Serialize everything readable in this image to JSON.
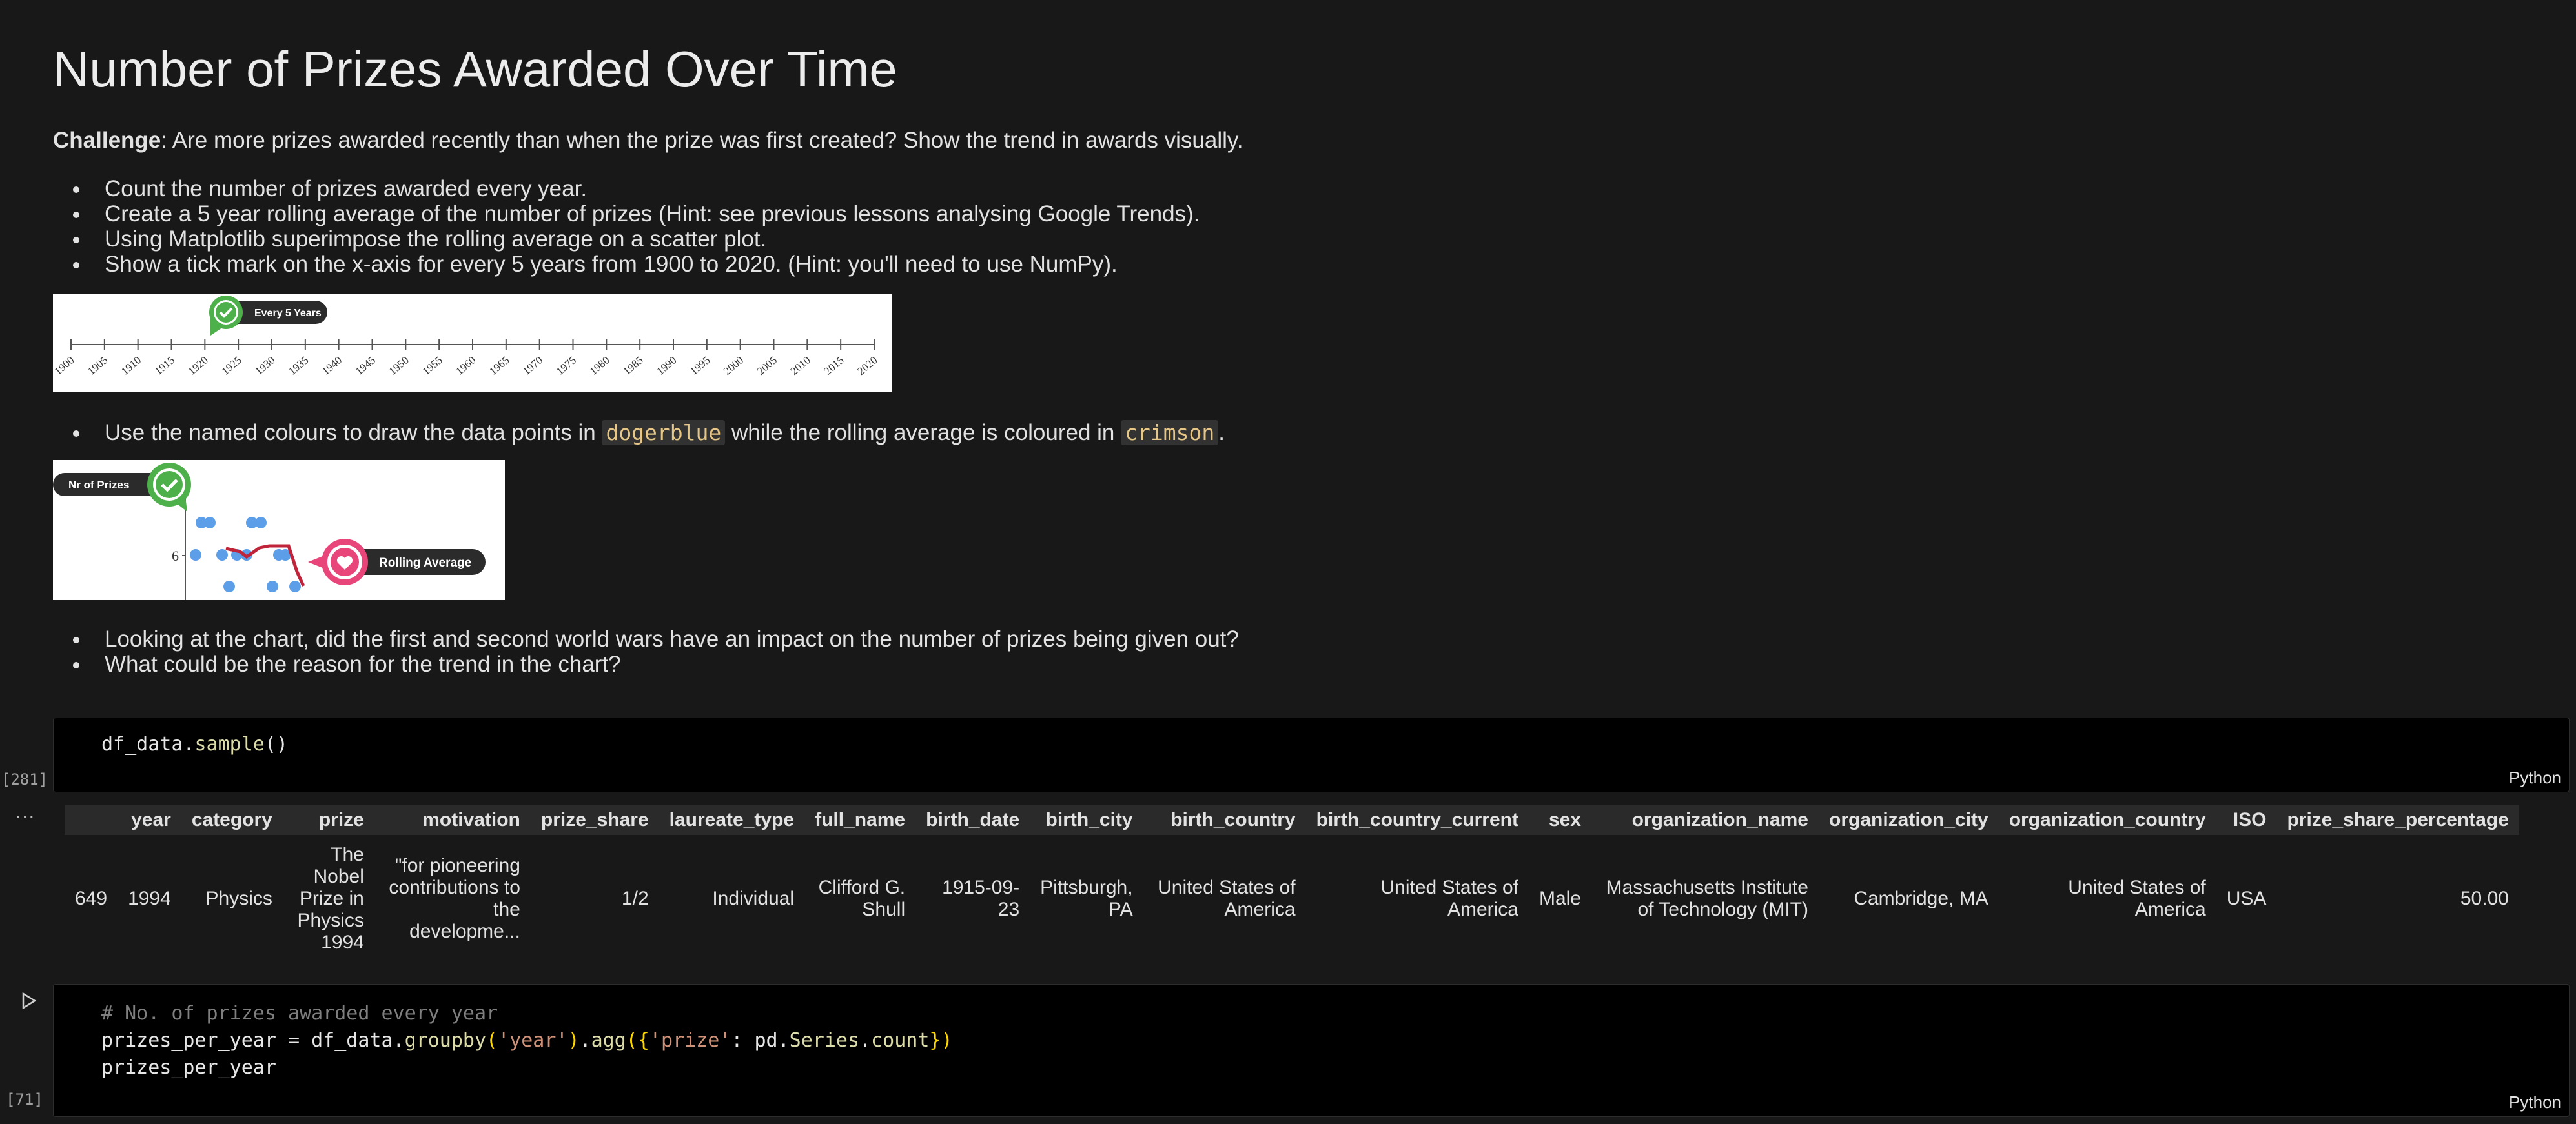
{
  "heading": "Number of Prizes Awarded Over Time",
  "challenge": {
    "label": "Challenge",
    "text": ": Are more prizes awarded recently than when the prize was first created? Show the trend in awards visually."
  },
  "bullets1": [
    "Count the number of prizes awarded every year.",
    "Create a 5 year rolling average of the number of prizes (Hint: see previous lessons analysing Google Trends).",
    "Using Matplotlib superimpose the rolling average on a scatter plot.",
    "Show a tick mark on the x-axis for every 5 years from 1900 to 2020. (Hint: you'll need to use NumPy)."
  ],
  "image1": {
    "badge": "Every 5 Years",
    "ticks": [
      "1900",
      "1905",
      "1910",
      "1915",
      "1920",
      "1925",
      "1930",
      "1935",
      "1940",
      "1945",
      "1950",
      "1955",
      "1960",
      "1965",
      "1970",
      "1975",
      "1980",
      "1985",
      "1990",
      "1995",
      "2000",
      "2005",
      "2010",
      "2015",
      "2020"
    ]
  },
  "bullet2": {
    "pre": "Use the named colours to draw the data points in ",
    "code1": "dogerblue",
    "mid": " while the rolling average is coloured in ",
    "code2": "crimson",
    "post": "."
  },
  "image2": {
    "badge_left": "Nr of Prizes",
    "badge_right": "Rolling Average",
    "y_tick": "6"
  },
  "bullets3": [
    "Looking at the chart, did the first and second world wars have an impact on the number of prizes being given out?",
    "What could be the reason for the trend in the chart?"
  ],
  "cell1": {
    "exec": "[281]",
    "code_obj": "df_data",
    "code_dot": ".",
    "code_fn": "sample",
    "code_paren": "()",
    "lang": "Python"
  },
  "output_dots": "...",
  "table": {
    "columns": [
      "",
      "year",
      "category",
      "prize",
      "motivation",
      "prize_share",
      "laureate_type",
      "full_name",
      "birth_date",
      "birth_city",
      "birth_country",
      "birth_country_current",
      "sex",
      "organization_name",
      "organization_city",
      "organization_country",
      "ISO",
      "prize_share_percentage"
    ],
    "row": [
      "649",
      "1994",
      "Physics",
      "The Nobel Prize in Physics 1994",
      "\"for pioneering contributions to the developme...",
      "1/2",
      "Individual",
      "Clifford G. Shull",
      "1915-09-23",
      "Pittsburgh, PA",
      "United States of America",
      "United States of America",
      "Male",
      "Massachusetts Institute of Technology (MIT)",
      "Cambridge, MA",
      "United States of America",
      "USA",
      "50.00"
    ]
  },
  "cell2": {
    "exec": "[71]",
    "comment": "# No. of prizes awarded every year",
    "l2_a": "prizes_per_year = df_data",
    "l2_dot": ".",
    "l2_fn1": "groupby",
    "l2_p1": "(",
    "l2_s1": "'year'",
    "l2_p2": ")",
    "l2_dot2": ".",
    "l2_fn2": "agg",
    "l2_p3": "({",
    "l2_s2": "'prize'",
    "l2_b": ": pd",
    "l2_dot3": ".",
    "l2_c": "Series",
    "l2_dot4": ".",
    "l2_d": "count",
    "l2_p4": "})",
    "line3": "prizes_per_year",
    "lang": "Python"
  },
  "colors": {
    "dodgerblue": "#5c9ee8",
    "crimson": "#c0243a",
    "check_green": "#4db04a",
    "heart_pink": "#e8457a"
  }
}
